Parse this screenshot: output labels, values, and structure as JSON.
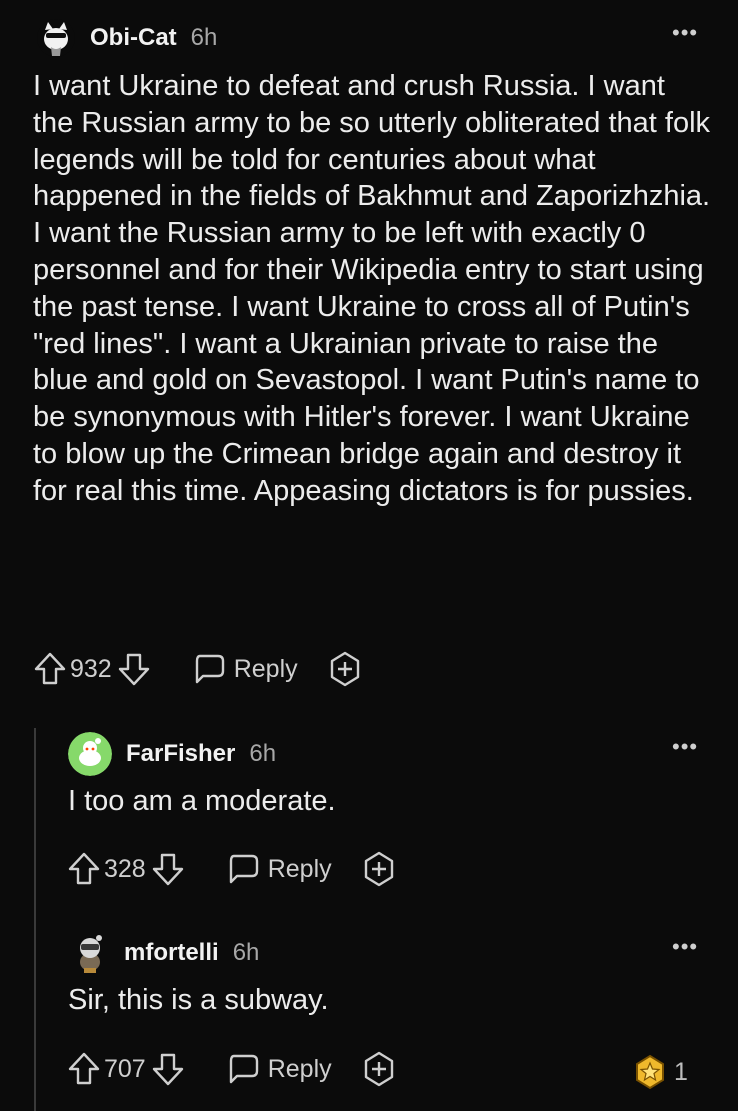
{
  "comments": [
    {
      "user": "Obi-Cat",
      "time": "6h",
      "text": "I want Ukraine to defeat and crush Russia. I want the Russian army to be so utterly obliterated that folk legends will be told for centuries about what happened in the fields of Bakhmut and Zaporizhzhia. I want the Russian army to be left with exactly 0 personnel and for their Wikipedia entry to start using the past tense. I want Ukraine to cross all of Putin's \"red lines\". I want a Ukrainian private to raise the blue and gold on Sevastopol. I want Putin's name to be synonymous with Hitler's forever. I want Ukraine to blow up the Crimean bridge again and destroy it for real this time. Appeasing dictators is for pussies.",
      "votes": "932",
      "reply_label": "Reply",
      "more_label": "•••"
    },
    {
      "user": "FarFisher",
      "time": "6h",
      "text": "I too am a moderate.",
      "votes": "328",
      "reply_label": "Reply",
      "more_label": "•••"
    },
    {
      "user": "mfortelli",
      "time": "6h",
      "text": "Sir, this is a subway.",
      "votes": "707",
      "reply_label": "Reply",
      "more_label": "•••",
      "award_count": "1"
    }
  ],
  "icons": {
    "upvote": "upvote-icon",
    "downvote": "downvote-icon",
    "reply": "speech-bubble-icon",
    "award": "award-icon",
    "more": "more-icon"
  },
  "colors": {
    "background": "#0b0b0b",
    "text": "#e8e8e8",
    "muted": "#a8a8a8",
    "avatar_green": "#86d96a",
    "award_gold": "#f0b92c"
  }
}
